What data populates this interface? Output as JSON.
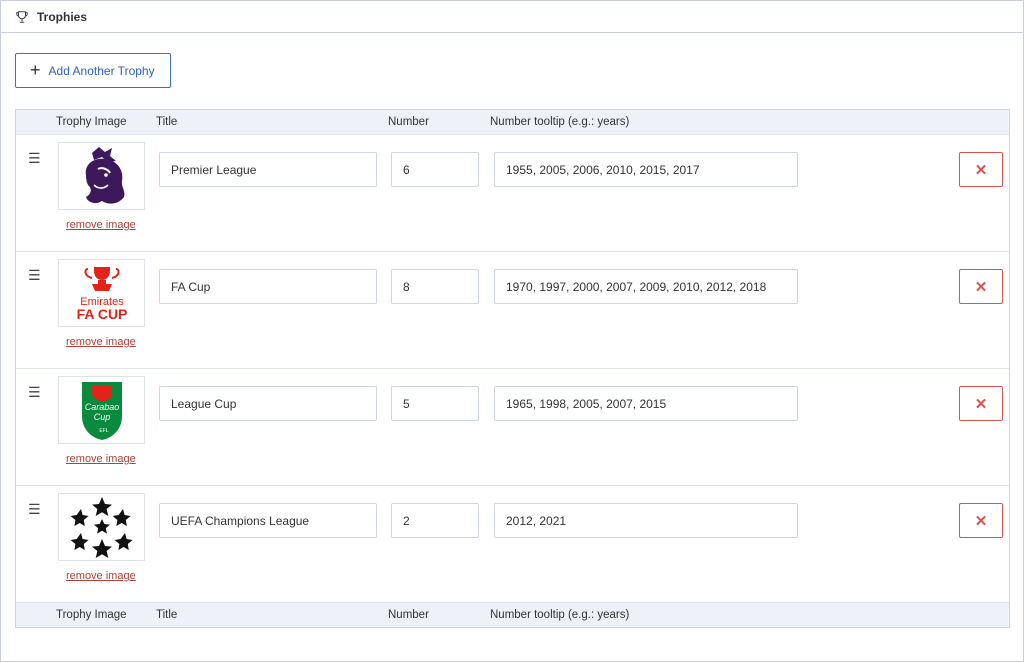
{
  "panel": {
    "title": "Trophies",
    "icon": "trophy-icon"
  },
  "toolbar": {
    "add_label": "Add Another Trophy"
  },
  "columns": {
    "image": "Trophy Image",
    "title": "Title",
    "number": "Number",
    "tooltip": "Number tooltip (e.g.: years)"
  },
  "rows": [
    {
      "logo": "premier-league-logo",
      "title": "Premier League",
      "number": "6",
      "tooltip": "1955, 2005, 2006, 2010, 2015, 2017",
      "remove_label": "remove image"
    },
    {
      "logo": "fa-cup-logo",
      "logo_text_1": "Emirates",
      "logo_text_2": "FA CUP",
      "title": "FA Cup",
      "number": "8",
      "tooltip": "1970, 1997, 2000, 2007, 2009, 2010, 2012, 2018",
      "remove_label": "remove image"
    },
    {
      "logo": "league-cup-logo",
      "logo_text_1": "Carabao",
      "logo_text_2": "Cup",
      "logo_text_3": "EFL",
      "title": "League Cup",
      "number": "5",
      "tooltip": "1965, 1998, 2005, 2007, 2015",
      "remove_label": "remove image"
    },
    {
      "logo": "champions-league-logo",
      "title": "UEFA Champions League",
      "number": "2",
      "tooltip": "2012, 2021",
      "remove_label": "remove image"
    }
  ],
  "colors": {
    "accent": "#2f62b8",
    "danger": "#d9534f",
    "header_bg": "#ecf2f7"
  }
}
